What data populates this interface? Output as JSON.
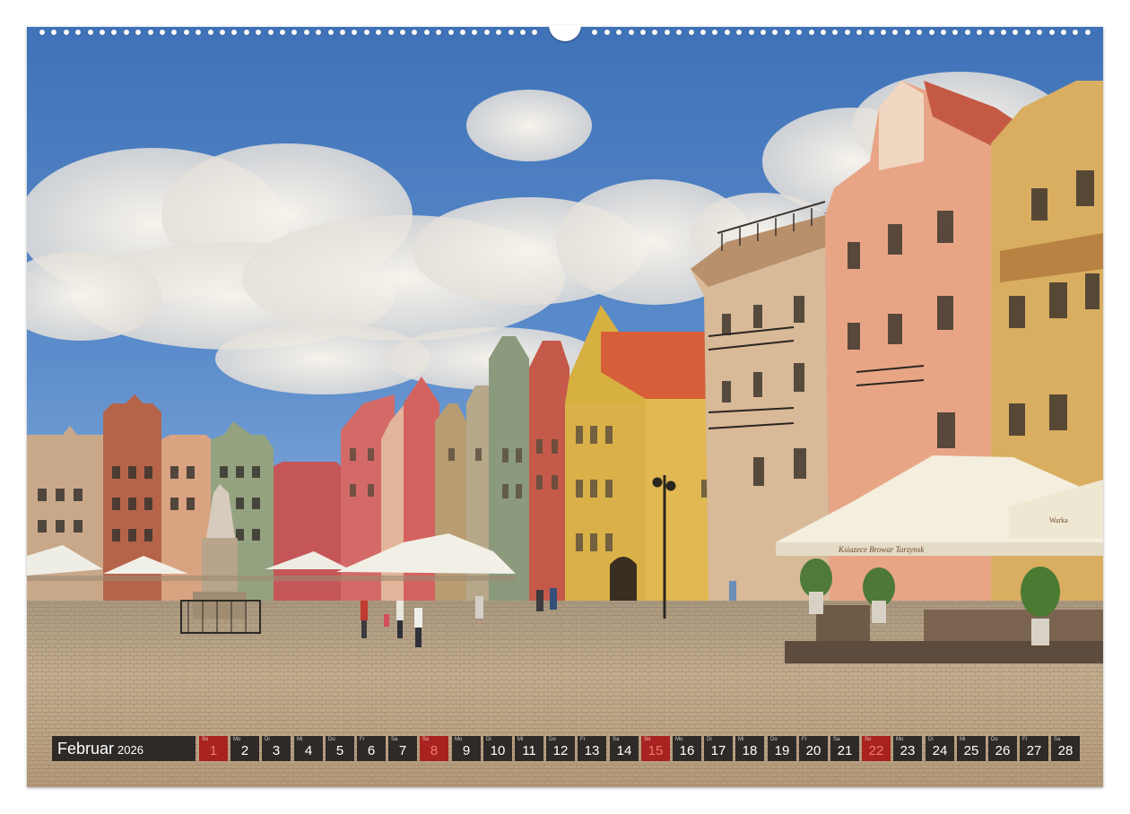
{
  "calendar": {
    "month": "Februar",
    "year": "2026",
    "days": [
      {
        "wd": "So",
        "num": "1",
        "sunday": true
      },
      {
        "wd": "Mo",
        "num": "2"
      },
      {
        "wd": "Di",
        "num": "3"
      },
      {
        "wd": "Mi",
        "num": "4"
      },
      {
        "wd": "Do",
        "num": "5"
      },
      {
        "wd": "Fr",
        "num": "6"
      },
      {
        "wd": "Sa",
        "num": "7"
      },
      {
        "wd": "So",
        "num": "8",
        "sunday": true
      },
      {
        "wd": "Mo",
        "num": "9"
      },
      {
        "wd": "Di",
        "num": "10"
      },
      {
        "wd": "Mi",
        "num": "11"
      },
      {
        "wd": "Do",
        "num": "12"
      },
      {
        "wd": "Fr",
        "num": "13"
      },
      {
        "wd": "Sa",
        "num": "14"
      },
      {
        "wd": "So",
        "num": "15",
        "sunday": true
      },
      {
        "wd": "Mo",
        "num": "16"
      },
      {
        "wd": "Di",
        "num": "17"
      },
      {
        "wd": "Mi",
        "num": "18"
      },
      {
        "wd": "Do",
        "num": "19"
      },
      {
        "wd": "Fr",
        "num": "20"
      },
      {
        "wd": "Sa",
        "num": "21"
      },
      {
        "wd": "So",
        "num": "22",
        "sunday": true
      },
      {
        "wd": "Mo",
        "num": "23"
      },
      {
        "wd": "Di",
        "num": "24"
      },
      {
        "wd": "Mi",
        "num": "25"
      },
      {
        "wd": "Do",
        "num": "26"
      },
      {
        "wd": "Fr",
        "num": "27"
      },
      {
        "wd": "Sa",
        "num": "28"
      }
    ]
  },
  "colors": {
    "bar": "#2d2a28",
    "sunday": "#a8231f",
    "sky": "#4c7ec0",
    "cobblestone": "#bfa98c"
  },
  "photo": {
    "umbrella_text": "Ksiazece Browar Tarzynsk",
    "umbrella_brand": "Warka"
  }
}
